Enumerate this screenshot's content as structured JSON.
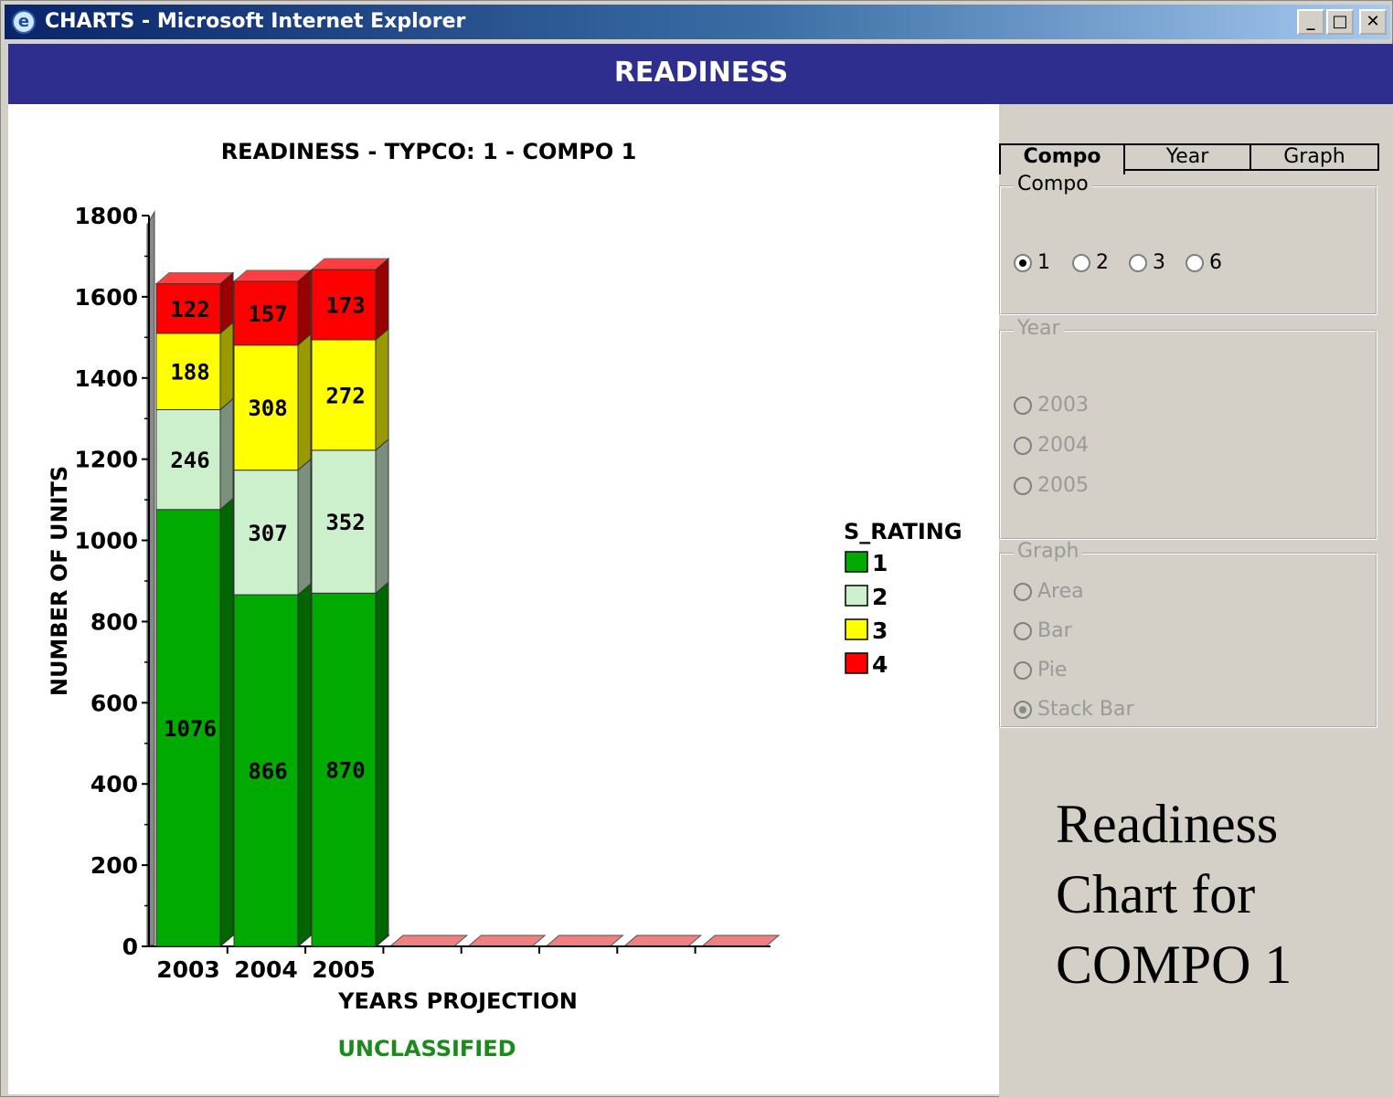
{
  "window": {
    "title": "CHARTS - Microsoft Internet Explorer",
    "icon": "ie-icon",
    "controls": {
      "minimize": "_",
      "maximize": "□",
      "close": "✕"
    }
  },
  "banner": {
    "title": "READINESS"
  },
  "chart_data": {
    "type": "bar",
    "stacked": true,
    "title": "READINESS - TYPCO: 1  - COMPO 1",
    "xlabel": "YEARS PROJECTION",
    "ylabel": "NUMBER OF UNITS",
    "ylim": [
      0,
      1800
    ],
    "yticks": [
      "0",
      "200",
      "400",
      "600",
      "800",
      "1000",
      "1200",
      "1400",
      "1600",
      "1800"
    ],
    "categories": [
      "2003",
      "2004",
      "2005"
    ],
    "series": [
      {
        "name": "1",
        "color": "#00aa00",
        "values": [
          1076,
          866,
          870
        ]
      },
      {
        "name": "2",
        "color": "#ccf0cc",
        "values": [
          246,
          307,
          352
        ]
      },
      {
        "name": "3",
        "color": "#ffff00",
        "values": [
          188,
          308,
          272
        ]
      },
      {
        "name": "4",
        "color": "#ff0000",
        "values": [
          122,
          157,
          173
        ]
      }
    ],
    "legend_title": "S_RATING",
    "legend_position": "right",
    "footer": "UNCLASSIFIED",
    "footer_color": "#1a8a1a"
  },
  "tabs": [
    "Compo",
    "Year",
    "Graph"
  ],
  "compo_group": {
    "label": "Compo",
    "options": [
      "1",
      "2",
      "3",
      "6"
    ],
    "selected": "1"
  },
  "year_group": {
    "label": "Year",
    "options": [
      "2003",
      "2004",
      "2005"
    ]
  },
  "graph_group": {
    "label": "Graph",
    "options": [
      "Area",
      "Bar",
      "Pie",
      "Stack Bar"
    ],
    "selected": "Stack Bar"
  },
  "caption": "Readiness Chart for COMPO 1"
}
